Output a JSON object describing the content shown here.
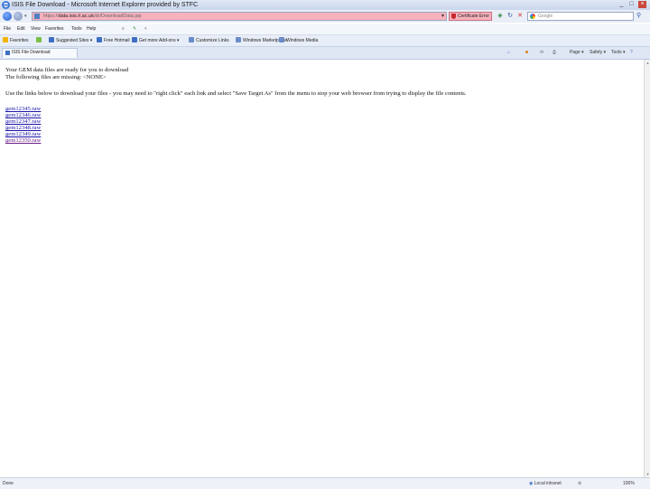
{
  "window": {
    "title": "ISIS File Download - Microsoft Internet Explorer provided by STFC",
    "controls": [
      "_",
      "□",
      "×"
    ]
  },
  "address_bar": {
    "url_prefix": "https://",
    "url_host": "data.isis.rl.ac.uk",
    "url_path": "/dr/DownloadData.jsp",
    "certificate_label": "Certificate Error"
  },
  "search": {
    "placeholder": "Google"
  },
  "menu": [
    "File",
    "Edit",
    "View",
    "Favorites",
    "Tools",
    "Help"
  ],
  "favorites_bar": {
    "favorites_label": "Favorites",
    "items": [
      "Suggested Sites ▾",
      "Free Hotmail",
      "Get more Add-ons ▾",
      "Customize Links",
      "Windows Marketplace",
      "Windows Media"
    ]
  },
  "tab": {
    "label": "ISIS File Download"
  },
  "command_bar": [
    "Page ▾",
    "Safety ▾",
    "Tools ▾"
  ],
  "content": {
    "line1": "Your GEM data files are ready for you to download",
    "line2": "The following files are missing: <NONE>",
    "instructions": "Use the links below to download your files - you may need to \"right click\" each link and select \"Save Target As\" from the menu to stop your web browser from trying to display the file contents.",
    "files": [
      "gem12345.raw",
      "gem12346.raw",
      "gem12347.raw",
      "gem12348.raw",
      "gem12349.raw",
      "gem12350.raw"
    ]
  },
  "status": {
    "left": "Done",
    "zone": "Local intranet",
    "zoom": "100%"
  },
  "colors": {
    "certificate_error": "#f7b2bd",
    "link": "#1a14a8",
    "visited_link": "#6a1b86"
  }
}
